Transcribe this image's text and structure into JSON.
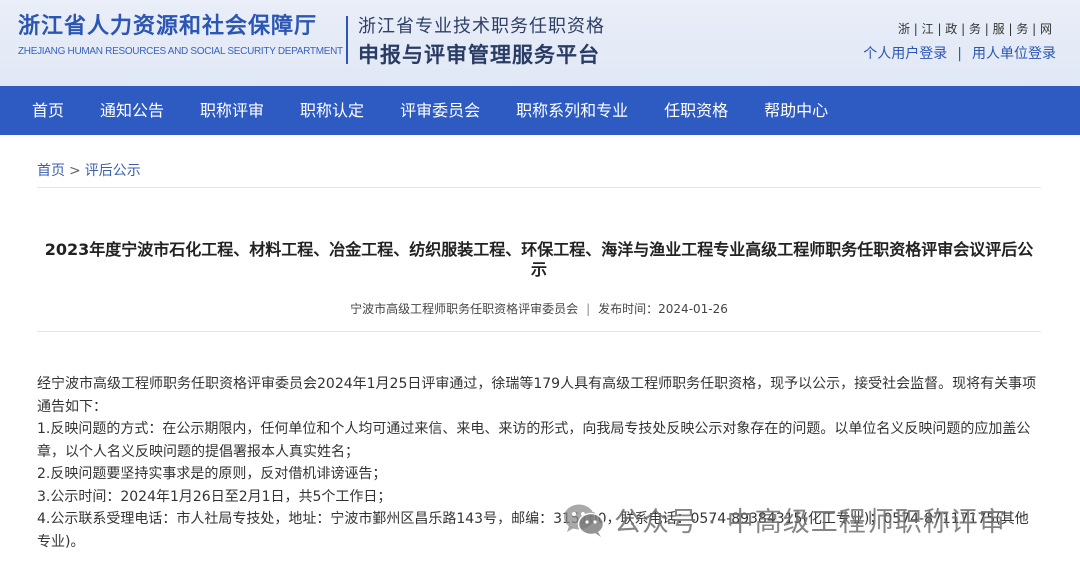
{
  "header": {
    "dept_cn": "浙江省人力资源和社会保障厅",
    "dept_en": "ZHEJIANG HUMAN RESOURCES AND SOCIAL SECURITY DEPARTMENT",
    "platform_sub": "浙江省专业技术职务任职资格",
    "platform_title": "申报与评审管理服务平台",
    "site_name": "浙 | 江 | 政 | 务 | 服 | 务 | 网",
    "personal_login": "个人用户登录",
    "login_sep": "|",
    "unit_login": "用人单位登录"
  },
  "nav": {
    "items": [
      "首页",
      "通知公告",
      "职称评审",
      "职称认定",
      "评审委员会",
      "职称系列和专业",
      "任职资格",
      "帮助中心"
    ]
  },
  "breadcrumb": {
    "home": "首页",
    "arrow": ">",
    "current": "评后公示"
  },
  "article": {
    "title": "2023年度宁波市石化工程、材料工程、冶金工程、纺织服装工程、环保工程、海洋与渔业工程专业高级工程师职务任职资格评审会议评后公示",
    "source": "宁波市高级工程师职务任职资格评审委员会",
    "meta_sep": "|",
    "publish_label": "发布时间：",
    "publish_date": "2024-01-26",
    "paragraphs": [
      "经宁波市高级工程师职务任职资格评审委员会2024年1月25日评审通过，徐瑞等179人具有高级工程师职务任职资格，现予以公示，接受社会监督。现将有关事项通告如下：",
      "1.反映问题的方式：在公示期限内，任何单位和个人均可通过来信、来电、来访的形式，向我局专技处反映公示对象存在的问题。以单位名义反映问题的应加盖公章，以个人名义反映问题的提倡署报本人真实姓名；",
      "2.反映问题要坚持实事求是的原则，反对借机诽谤诬告；",
      "3.公示时间：2024年1月26日至2月1日，共5个工作日；",
      "4.公示联系受理电话：市人社局专技处，地址：宁波市鄞州区昌乐路143号，邮编：315100，联系电话：0574-89384315(化工专业)；0574-87117175(其他专业)。"
    ]
  },
  "watermark": {
    "text": "公众号 · 中高级工程师职称评审",
    "icon": "wechat-icon"
  },
  "colors": {
    "brand": "#2e5bc2",
    "header_bg": "#e5ebf6",
    "link": "#3a5fae"
  }
}
